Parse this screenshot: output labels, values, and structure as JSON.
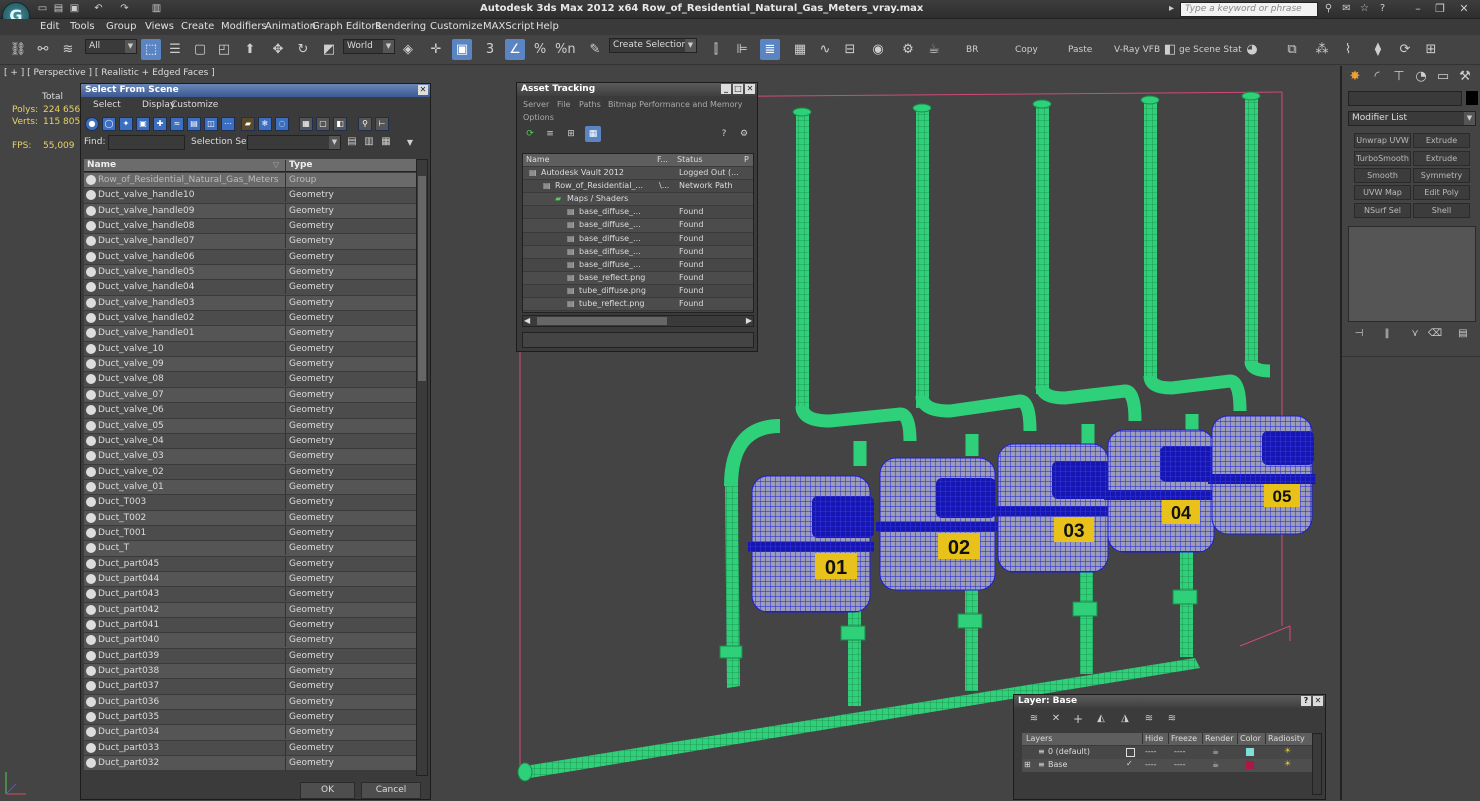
{
  "window": {
    "title": "Autodesk 3ds Max  2012 x64      Row_of_Residential_Natural_Gas_Meters_vray.max",
    "search_placeholder": "Type a keyword or phrase",
    "app_icon": "3ds-max-icon"
  },
  "menu": [
    "Edit",
    "Tools",
    "Group",
    "Views",
    "Create",
    "Modifiers",
    "Animation",
    "Graph Editors",
    "Rendering",
    "Customize",
    "MAXScript",
    "Help"
  ],
  "toolbar": {
    "selection_filter": "All",
    "coord_system": "World",
    "named_selection": "Create Selection Se",
    "br_label": "BR",
    "copy_label": "Copy",
    "paste_label": "Paste",
    "vray_label": "V-Ray VFB",
    "scene_state_label": "ge Scene Stat",
    "snap_label": "3",
    "angle_snap_label": "%",
    "percent_snap_label": "%n"
  },
  "viewport": {
    "label": "[ + ] [ Perspective ] [ Realistic + Edged Faces ]",
    "stats": {
      "total_label": "Total",
      "polys_label": "Polys:",
      "polys_value": "224 656",
      "verts_label": "Verts:",
      "verts_value": "115 805",
      "fps_label": "FPS:",
      "fps_value": "55,009"
    },
    "meter_numbers": [
      "01",
      "02",
      "03",
      "04",
      "05"
    ],
    "colors": {
      "pipe": "#2fd07a",
      "meter": "#1d1dd8",
      "background": "#444444",
      "label": "#e8c21a"
    }
  },
  "select_from_scene": {
    "title": "Select From Scene",
    "menu": [
      "Select",
      "Display",
      "Customize"
    ],
    "find_label": "Find:",
    "find_value": "",
    "selection_set_label": "Selection Set:",
    "selection_set_value": "",
    "columns": {
      "name": "Name",
      "type": "Type"
    },
    "rows": [
      {
        "name": "Row_of_Residential_Natural_Gas_Meters",
        "type": "Group"
      },
      {
        "name": "Duct_valve_handle10",
        "type": "Geometry"
      },
      {
        "name": "Duct_valve_handle09",
        "type": "Geometry"
      },
      {
        "name": "Duct_valve_handle08",
        "type": "Geometry"
      },
      {
        "name": "Duct_valve_handle07",
        "type": "Geometry"
      },
      {
        "name": "Duct_valve_handle06",
        "type": "Geometry"
      },
      {
        "name": "Duct_valve_handle05",
        "type": "Geometry"
      },
      {
        "name": "Duct_valve_handle04",
        "type": "Geometry"
      },
      {
        "name": "Duct_valve_handle03",
        "type": "Geometry"
      },
      {
        "name": "Duct_valve_handle02",
        "type": "Geometry"
      },
      {
        "name": "Duct_valve_handle01",
        "type": "Geometry"
      },
      {
        "name": "Duct_valve_10",
        "type": "Geometry"
      },
      {
        "name": "Duct_valve_09",
        "type": "Geometry"
      },
      {
        "name": "Duct_valve_08",
        "type": "Geometry"
      },
      {
        "name": "Duct_valve_07",
        "type": "Geometry"
      },
      {
        "name": "Duct_valve_06",
        "type": "Geometry"
      },
      {
        "name": "Duct_valve_05",
        "type": "Geometry"
      },
      {
        "name": "Duct_valve_04",
        "type": "Geometry"
      },
      {
        "name": "Duct_valve_03",
        "type": "Geometry"
      },
      {
        "name": "Duct_valve_02",
        "type": "Geometry"
      },
      {
        "name": "Duct_valve_01",
        "type": "Geometry"
      },
      {
        "name": "Duct_T003",
        "type": "Geometry"
      },
      {
        "name": "Duct_T002",
        "type": "Geometry"
      },
      {
        "name": "Duct_T001",
        "type": "Geometry"
      },
      {
        "name": "Duct_T",
        "type": "Geometry"
      },
      {
        "name": "Duct_part045",
        "type": "Geometry"
      },
      {
        "name": "Duct_part044",
        "type": "Geometry"
      },
      {
        "name": "Duct_part043",
        "type": "Geometry"
      },
      {
        "name": "Duct_part042",
        "type": "Geometry"
      },
      {
        "name": "Duct_part041",
        "type": "Geometry"
      },
      {
        "name": "Duct_part040",
        "type": "Geometry"
      },
      {
        "name": "Duct_part039",
        "type": "Geometry"
      },
      {
        "name": "Duct_part038",
        "type": "Geometry"
      },
      {
        "name": "Duct_part037",
        "type": "Geometry"
      },
      {
        "name": "Duct_part036",
        "type": "Geometry"
      },
      {
        "name": "Duct_part035",
        "type": "Geometry"
      },
      {
        "name": "Duct_part034",
        "type": "Geometry"
      },
      {
        "name": "Duct_part033",
        "type": "Geometry"
      },
      {
        "name": "Duct_part032",
        "type": "Geometry"
      }
    ],
    "ok_label": "OK",
    "cancel_label": "Cancel"
  },
  "asset_tracking": {
    "title": "Asset Tracking",
    "menu": [
      "Server",
      "File",
      "Paths",
      "Bitmap Performance and Memory",
      "Options"
    ],
    "columns": {
      "name": "Name",
      "f": "F...",
      "status": "Status",
      "p": "P"
    },
    "rows": [
      {
        "name": "Autodesk Vault 2012",
        "f": "",
        "status": "Logged Out (..."
      },
      {
        "name": "Row_of_Residential_...",
        "f": "\\...",
        "status": "Network Path"
      },
      {
        "name": "Maps / Shaders",
        "f": "",
        "status": ""
      },
      {
        "name": "base_diffuse_...",
        "f": "",
        "status": "Found"
      },
      {
        "name": "base_diffuse_...",
        "f": "",
        "status": "Found"
      },
      {
        "name": "base_diffuse_...",
        "f": "",
        "status": "Found"
      },
      {
        "name": "base_diffuse_...",
        "f": "",
        "status": "Found"
      },
      {
        "name": "base_diffuse_...",
        "f": "",
        "status": "Found"
      },
      {
        "name": "base_reflect.png",
        "f": "",
        "status": "Found"
      },
      {
        "name": "tube_diffuse.png",
        "f": "",
        "status": "Found"
      },
      {
        "name": "tube_reflect.png",
        "f": "",
        "status": "Found"
      }
    ]
  },
  "command_panel": {
    "name_value": "",
    "modifier_list_label": "Modifier List",
    "modifiers": [
      "Unwrap UVW",
      "Extrude",
      "TurboSmooth",
      "Extrude",
      "Smooth",
      "Symmetry",
      "UVW Map",
      "Edit Poly",
      "NSurf Sel",
      "Shell"
    ]
  },
  "layer_dialog": {
    "title": "Layer: Base",
    "columns": [
      "Layers",
      "Hide",
      "Freeze",
      "Render",
      "Color",
      "Radiosity"
    ],
    "rows": [
      {
        "name": "0 (default)",
        "hide": "----",
        "freeze": "----",
        "color": "#7fe0d8"
      },
      {
        "name": "Base",
        "hide": "----",
        "freeze": "----",
        "color": "#b0154a"
      }
    ]
  }
}
